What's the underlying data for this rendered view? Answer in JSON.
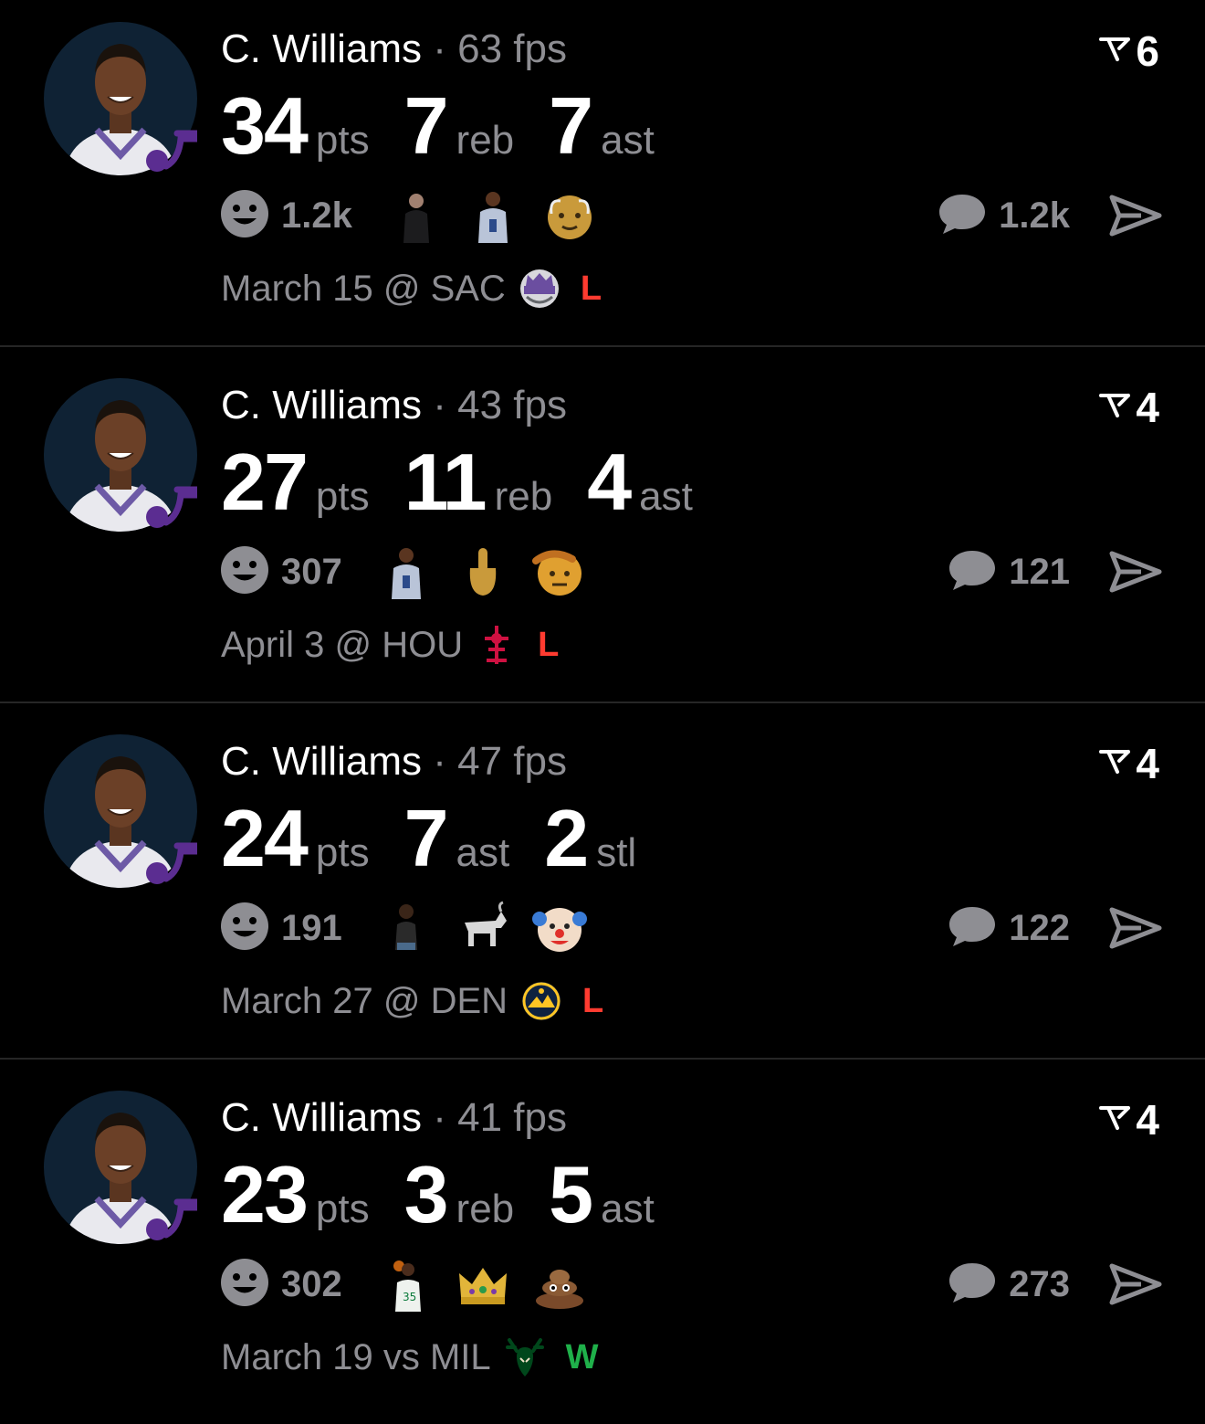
{
  "colors": {
    "background": "#000000",
    "primary_text": "#ffffff",
    "secondary_text": "#8e8e93",
    "loss": "#ff3b30",
    "win": "#1fb04a",
    "divider": "#262626"
  },
  "cards": [
    {
      "player": "C. Williams",
      "fps": "63 fps",
      "rank": "6",
      "stats": [
        {
          "value": "34",
          "unit": "pts"
        },
        {
          "value": "7",
          "unit": "reb"
        },
        {
          "value": "7",
          "unit": "ast"
        }
      ],
      "reaction_count": "1.2k",
      "reaction_emojis": [
        "person-in-black-emoji",
        "player-photo-emoji",
        "old-man-emoji"
      ],
      "comment_count": "1.2k",
      "game": "March 15 @ SAC",
      "team_logo": "kings-logo",
      "result": "L",
      "result_color": "#ff3b30"
    },
    {
      "player": "C. Williams",
      "fps": "43 fps",
      "rank": "4",
      "stats": [
        {
          "value": "27",
          "unit": "pts"
        },
        {
          "value": "11",
          "unit": "reb"
        },
        {
          "value": "4",
          "unit": "ast"
        }
      ],
      "reaction_count": "307",
      "reaction_emojis": [
        "player-photo-emoji",
        "middle-finger-emoji",
        "saluting-face-emoji"
      ],
      "comment_count": "121",
      "game": "April 3 @ HOU",
      "team_logo": "rockets-logo",
      "result": "L",
      "result_color": "#ff3b30"
    },
    {
      "player": "C. Williams",
      "fps": "47 fps",
      "rank": "4",
      "stats": [
        {
          "value": "24",
          "unit": "pts"
        },
        {
          "value": "7",
          "unit": "ast"
        },
        {
          "value": "2",
          "unit": "stl"
        }
      ],
      "reaction_count": "191",
      "reaction_emojis": [
        "person-sitting-emoji",
        "goat-emoji",
        "clown-face-emoji"
      ],
      "comment_count": "122",
      "game": "March 27 @ DEN",
      "team_logo": "nuggets-logo",
      "result": "L",
      "result_color": "#ff3b30"
    },
    {
      "player": "C. Williams",
      "fps": "41 fps",
      "rank": "4",
      "stats": [
        {
          "value": "23",
          "unit": "pts"
        },
        {
          "value": "3",
          "unit": "reb"
        },
        {
          "value": "5",
          "unit": "ast"
        }
      ],
      "reaction_count": "302",
      "reaction_emojis": [
        "celtics-player-emoji",
        "crown-emoji",
        "pile-of-poo-emoji"
      ],
      "comment_count": "273",
      "game": "March 19 vs MIL",
      "team_logo": "bucks-logo",
      "result": "W",
      "result_color": "#1fb04a"
    }
  ]
}
